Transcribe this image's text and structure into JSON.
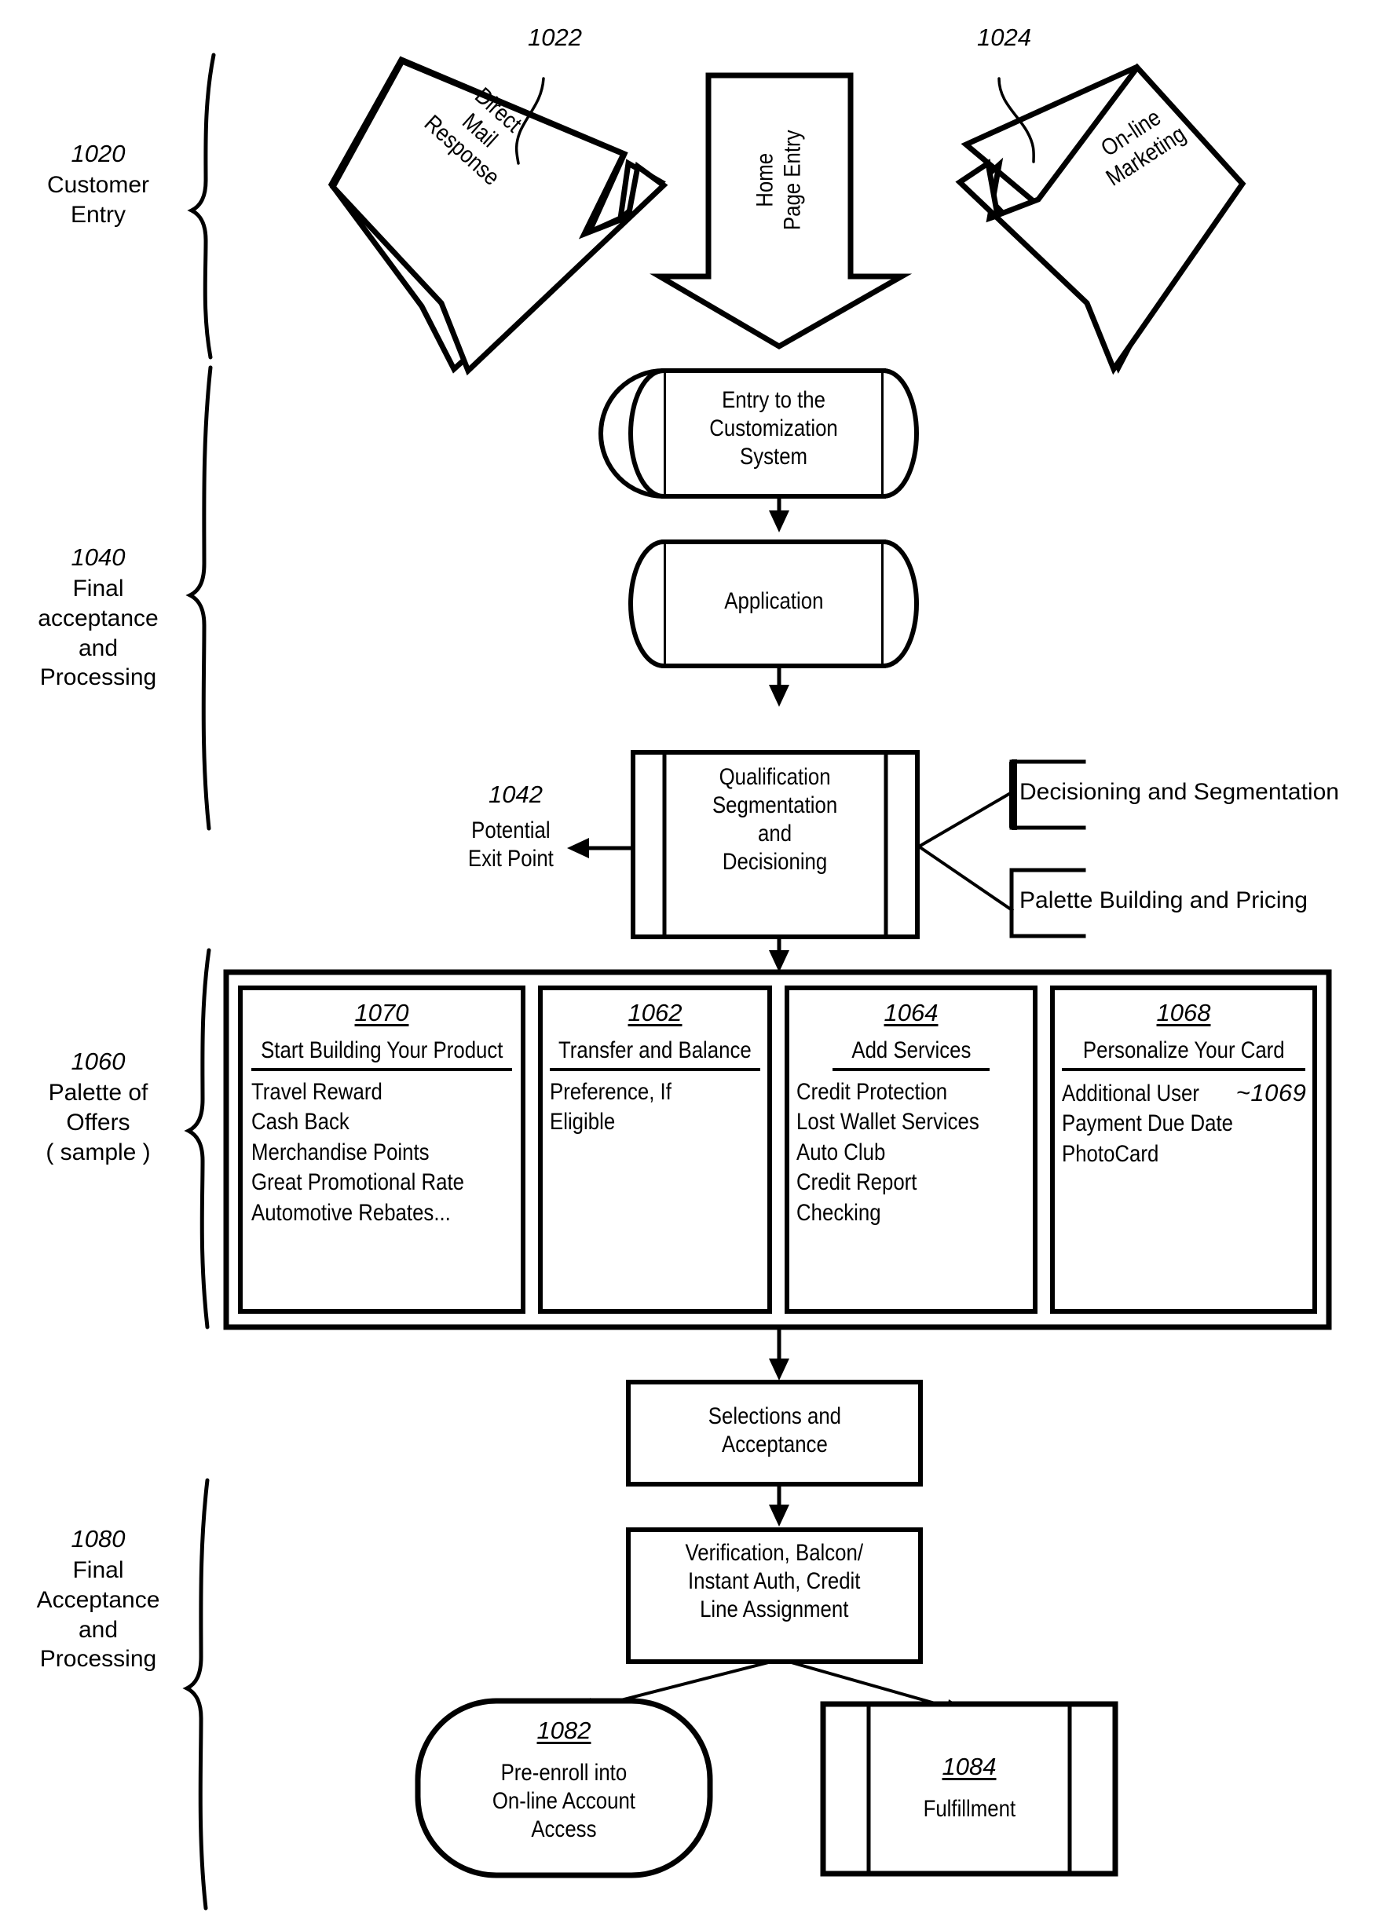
{
  "figure": {
    "type": "patent-flowchart",
    "title": "Customer entry, customization and fulfillment process flow"
  },
  "sections": [
    {
      "num": "1020",
      "label": "Customer\nEntry"
    },
    {
      "num": "1040",
      "label": "Final\nacceptance\nand\nProcessing"
    },
    {
      "num": "1060",
      "label": "Palette of\nOffers\n( sample )"
    },
    {
      "num": "1080",
      "label": "Final\nAcceptance\nand\nProcessing"
    }
  ],
  "entry_arrows": [
    {
      "num": "1022",
      "label": "Direct\nMail\nResponse",
      "kind": "diagonal-arrow-left"
    },
    {
      "num": "",
      "label": "Home\nPage Entry",
      "kind": "down-arrow-center"
    },
    {
      "num": "1024",
      "label": "On-line\nMarketing",
      "kind": "diagonal-arrow-right"
    }
  ],
  "nodes": {
    "entry_system": {
      "label": "Entry to the\nCustomization\nSystem",
      "shape": "subroutine"
    },
    "application": {
      "label": "Application",
      "shape": "subroutine"
    },
    "qualification": {
      "label": "Qualification\nSegmentation\nand\nDecisioning",
      "shape": "predefined-process"
    },
    "selections": {
      "label": "Selections and\nAcceptance",
      "shape": "rect"
    },
    "verification": {
      "label": "Verification, Balcon/\nInstant Auth, Credit\nLine Assignment",
      "shape": "rect"
    },
    "preenroll": {
      "num": "1082",
      "label": "Pre-enroll into\nOn-line Account\nAccess",
      "shape": "rounded"
    },
    "fulfillment": {
      "num": "1084",
      "label": "Fulfillment",
      "shape": "predefined-process"
    }
  },
  "exit_point": {
    "num": "1042",
    "label": "Potential\nExit Point"
  },
  "side_boxes": [
    {
      "label": "Decisioning and Segmentation"
    },
    {
      "label": "Palette Building and Pricing"
    }
  ],
  "palette_panels": [
    {
      "num": "1070",
      "heading": "Start Building Your Product",
      "items": [
        "Travel Reward",
        "Cash Back",
        "Merchandise Points",
        "Great Promotional Rate",
        "Automotive Rebates..."
      ]
    },
    {
      "num": "1062",
      "heading": "Transfer and Balance",
      "items": [
        "Preference, If Eligible"
      ]
    },
    {
      "num": "1064",
      "heading": "Add Services",
      "items": [
        "Credit Protection",
        "Lost Wallet Services",
        "Auto Club",
        "Credit Report Checking"
      ]
    },
    {
      "num": "1068",
      "heading": "Personalize Your Card",
      "items": [
        "Additional User",
        "Payment Due Date",
        "PhotoCard"
      ],
      "inline_ref": "~1069"
    }
  ],
  "colors": {
    "ink": "#000000",
    "paper": "#ffffff"
  }
}
